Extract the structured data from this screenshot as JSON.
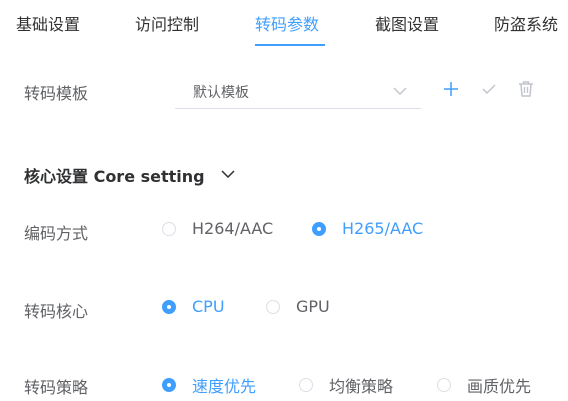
{
  "tabs": [
    {
      "label": "基础设置",
      "active": false
    },
    {
      "label": "访问控制",
      "active": false
    },
    {
      "label": "转码参数",
      "active": true
    },
    {
      "label": "截图设置",
      "active": false
    },
    {
      "label": "防盗系统",
      "active": false
    }
  ],
  "template": {
    "label": "转码模板",
    "selected": "默认模板",
    "actions": [
      "plus-icon",
      "check-icon",
      "trash-icon"
    ]
  },
  "core": {
    "title": "核心设置 Core setting",
    "encoding": {
      "label": "编码方式",
      "options": [
        "H264/AAC",
        "H265/AAC"
      ],
      "selected": "H265/AAC"
    },
    "engine": {
      "label": "转码核心",
      "options": [
        "CPU",
        "GPU"
      ],
      "selected": "CPU"
    },
    "strategy": {
      "label": "转码策略",
      "options": [
        "速度优先",
        "均衡策略",
        "画质优先"
      ],
      "selected": "速度优先"
    }
  },
  "colors": {
    "accent": "#409eff",
    "text": "#606266",
    "border": "#dcdfe6"
  }
}
